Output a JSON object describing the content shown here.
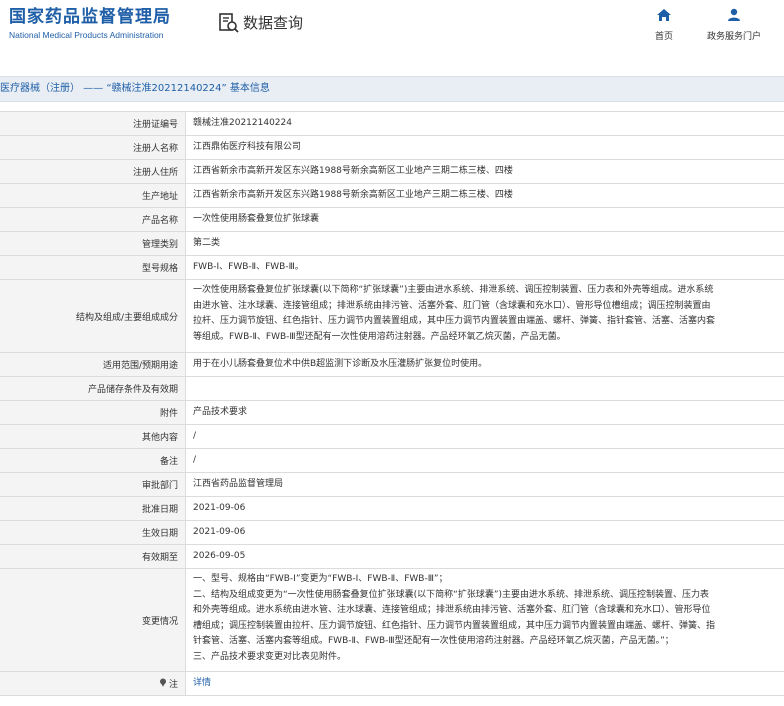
{
  "header": {
    "brand_cn": "国家药品监督管理局",
    "brand_en": "National Medical Products Administration",
    "query_label": "数据查询",
    "nav": [
      {
        "label": "首页",
        "icon": "home-icon"
      },
      {
        "label": "政务服务门户",
        "icon": "user-icon"
      }
    ]
  },
  "breadcrumb": "医疗器械（注册） —— “赣械注准20212140224” 基本信息",
  "rows": [
    {
      "label": "注册证编号",
      "lines": [
        "赣械注准20212140224"
      ]
    },
    {
      "label": "注册人名称",
      "lines": [
        "江西鼎佑医疗科技有限公司"
      ]
    },
    {
      "label": "注册人住所",
      "lines": [
        "江西省新余市高新开发区东兴路1988号新余高新区工业地产三期二栋三楼、四楼"
      ]
    },
    {
      "label": "生产地址",
      "lines": [
        "江西省新余市高新开发区东兴路1988号新余高新区工业地产三期二栋三楼、四楼"
      ]
    },
    {
      "label": "产品名称",
      "lines": [
        "一次性使用肠套叠复位扩张球囊"
      ]
    },
    {
      "label": "管理类别",
      "lines": [
        "第二类"
      ]
    },
    {
      "label": "型号规格",
      "lines": [
        "FWB-Ⅰ、FWB-Ⅱ、FWB-Ⅲ。"
      ]
    },
    {
      "label": "结构及组成/主要组成成分",
      "lines": [
        "一次性使用肠套叠复位扩张球囊(以下简称“扩张球囊”)主要由进水系统、排泄系统、调压控制装置、压力表和外壳等组成。进水系统",
        "由进水管、注水球囊、连接管组成；排泄系统由排污管、活塞外套、肛门管（含球囊和充水口）、管形导位槽组成；调压控制装置由",
        "拉杆、压力调节旋钮、红色指针、压力调节内置装置组成，其中压力调节内置装置由端盖、螺杆、弹簧、指针套管、活塞、活塞内套",
        "等组成。FWB-Ⅱ、FWB-Ⅲ型还配有一次性使用溶药注射器。产品经环氧乙烷灭菌，产品无菌。"
      ]
    },
    {
      "label": "适用范围/预期用途",
      "lines": [
        "用于在小儿肠套叠复位术中供B超监测下诊断及水压灌肠扩张复位时使用。"
      ]
    },
    {
      "label": "产品储存条件及有效期",
      "lines": [
        ""
      ]
    },
    {
      "label": "附件",
      "lines": [
        "产品技术要求"
      ]
    },
    {
      "label": "其他内容",
      "lines": [
        "/"
      ]
    },
    {
      "label": "备注",
      "lines": [
        "/"
      ]
    },
    {
      "label": "审批部门",
      "lines": [
        "江西省药品监督管理局"
      ]
    },
    {
      "label": "批准日期",
      "lines": [
        "2021-09-06"
      ]
    },
    {
      "label": "生效日期",
      "lines": [
        "2021-09-06"
      ]
    },
    {
      "label": "有效期至",
      "lines": [
        "2026-09-05"
      ]
    },
    {
      "label": "变更情况",
      "lines": [
        "一、型号、规格由“FWB-Ⅰ”变更为“FWB-Ⅰ、FWB-Ⅱ、FWB-Ⅲ”；",
        "二、结构及组成变更为“一次性使用肠套叠复位扩张球囊(以下简称“扩张球囊”)主要由进水系统、排泄系统、调压控制装置、压力表",
        "和外壳等组成。进水系统由进水管、注水球囊、连接管组成；排泄系统由排污管、活塞外套、肛门管（含球囊和充水口）、管形导位",
        "槽组成；调压控制装置由拉杆、压力调节旋钮、红色指针、压力调节内置装置组成，其中压力调节内置装置由端盖、螺杆、弹簧、指",
        "针套管、活塞、活塞内套等组成。FWB-Ⅱ、FWB-Ⅲ型还配有一次性使用溶药注射器。产品经环氧乙烷灭菌，产品无菌。”；",
        "三、产品技术要求变更对比表见附件。"
      ]
    },
    {
      "label": "注",
      "lines": [
        "详情"
      ],
      "link": true,
      "icon": "pin-icon"
    }
  ]
}
